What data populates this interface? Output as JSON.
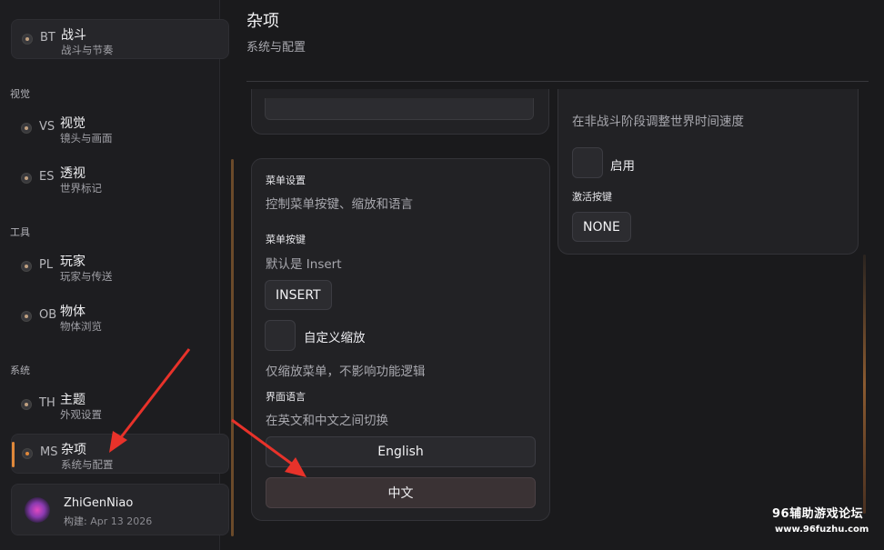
{
  "sidebar": {
    "top_item": {
      "code": "BT",
      "title": "战斗",
      "sub": "战斗与节奏"
    },
    "groups": [
      {
        "label": "视觉"
      },
      {
        "label": "工具"
      },
      {
        "label": "系统"
      }
    ],
    "items": [
      {
        "code": "VS",
        "title": "视觉",
        "sub": "镜头与画面"
      },
      {
        "code": "ES",
        "title": "透视",
        "sub": "世界标记"
      },
      {
        "code": "PL",
        "title": "玩家",
        "sub": "玩家与传送"
      },
      {
        "code": "OB",
        "title": "物体",
        "sub": "物体浏览"
      },
      {
        "code": "TH",
        "title": "主题",
        "sub": "外观设置"
      },
      {
        "code": "MS",
        "title": "杂项",
        "sub": "系统与配置"
      }
    ],
    "user": {
      "name": "ZhiGenNiao",
      "build_label": "构建:",
      "build_value": "Apr 13 2026"
    }
  },
  "header": {
    "title": "杂项",
    "subtitle": "系统与配置"
  },
  "menu_card": {
    "section_title": "菜单设置",
    "section_desc": "控制菜单按键、缩放和语言",
    "hotkey_label": "菜单按键",
    "hotkey_desc": "默认是 Insert",
    "hotkey_value": "INSERT",
    "scale_label": "自定义缩放",
    "scale_desc": "仅缩放菜单，不影响功能逻辑",
    "lang_label": "界面语言",
    "lang_desc": "在英文和中文之间切换",
    "lang_en": "English",
    "lang_zh": "中文"
  },
  "time_card": {
    "desc": "在非战斗阶段调整世界时间速度",
    "enable_label": "启用",
    "activate_label": "激活按键",
    "activate_value": "NONE"
  },
  "watermark": {
    "line1": "96辅助游戏论坛",
    "line2": "www.96fuzhu.com"
  },
  "colors": {
    "accent": "#e0883a",
    "arrow": "#e8322a"
  }
}
